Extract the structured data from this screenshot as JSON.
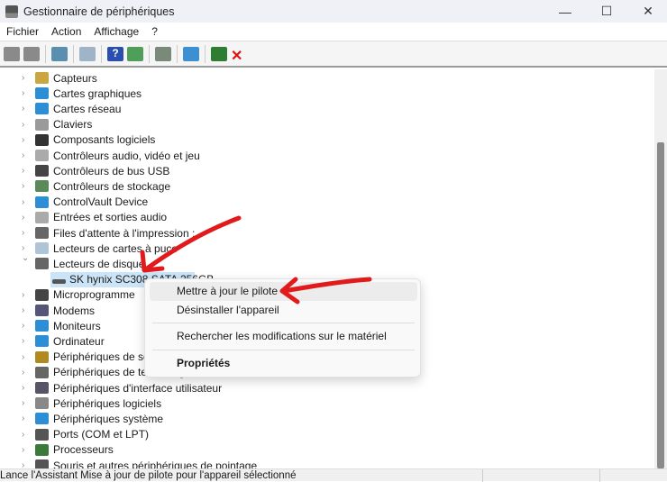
{
  "window": {
    "title": "Gestionnaire de périphériques",
    "minimize": "—",
    "maximize": "☐",
    "close": "✕"
  },
  "menubar": [
    "Fichier",
    "Action",
    "Affichage",
    "?"
  ],
  "toolbar": [
    {
      "icon": "back-arrow-icon",
      "color": "#8a8a8a"
    },
    {
      "icon": "forward-arrow-icon",
      "color": "#8a8a8a"
    },
    {
      "icon": "show-hide-console-tree-icon",
      "color": "#5b8fb0"
    },
    {
      "icon": "properties-icon",
      "color": "#a0b4c8"
    },
    {
      "icon": "help-icon",
      "color": "#2a4fb0"
    },
    {
      "icon": "action-pane-icon",
      "color": "#4f9e5a"
    },
    {
      "icon": "update-driver-icon",
      "color": "#7a8a7a"
    },
    {
      "icon": "scan-hardware-icon",
      "color": "#3c8fd0"
    },
    {
      "icon": "enable-device-icon",
      "color": "#2e7d32"
    },
    {
      "icon": "uninstall-device-icon",
      "color": "#e01010"
    }
  ],
  "tree": {
    "items": [
      {
        "label": "Capteurs",
        "color": "#c9a640"
      },
      {
        "label": "Cartes graphiques",
        "color": "#2c8fd6"
      },
      {
        "label": "Cartes réseau",
        "color": "#2c8fd6"
      },
      {
        "label": "Claviers",
        "color": "#9a9a9a"
      },
      {
        "label": "Composants logiciels",
        "color": "#333"
      },
      {
        "label": "Contrôleurs audio, vidéo et jeu",
        "color": "#aaa"
      },
      {
        "label": "Contrôleurs de bus USB",
        "color": "#444"
      },
      {
        "label": "Contrôleurs de stockage",
        "color": "#5a8a5a"
      },
      {
        "label": "ControlVault Device",
        "color": "#2c8fd6"
      },
      {
        "label": "Entrées et sorties audio",
        "color": "#aaa"
      },
      {
        "label": "Files d'attente à l'impression :",
        "color": "#666"
      },
      {
        "label": "Lecteurs de cartes à puce",
        "color": "#b0c4d8"
      },
      {
        "label": "Lecteurs de disque",
        "color": "#666",
        "expanded": true
      },
      {
        "label": "SK hynix SC308 SATA 256GB",
        "child": true,
        "selected": true
      },
      {
        "label": "Microprogramme",
        "color": "#444"
      },
      {
        "label": "Modems",
        "color": "#557"
      },
      {
        "label": "Moniteurs",
        "color": "#2c8fd6"
      },
      {
        "label": "Ordinateur",
        "color": "#2c8fd6"
      },
      {
        "label": "Périphériques de sécurité",
        "color": "#b08a20"
      },
      {
        "label": "Périphériques de technologie mémoire",
        "color": "#666"
      },
      {
        "label": "Périphériques d'interface utilisateur",
        "color": "#556"
      },
      {
        "label": "Périphériques logiciels",
        "color": "#888"
      },
      {
        "label": "Périphériques système",
        "color": "#2c8fd6"
      },
      {
        "label": "Ports (COM et LPT)",
        "color": "#555"
      },
      {
        "label": "Processeurs",
        "color": "#3a7a3a"
      },
      {
        "label": "Souris et autres périphériques de pointage",
        "color": "#555"
      }
    ]
  },
  "context_menu": {
    "update_driver": "Mettre à jour le pilote",
    "uninstall": "Désinstaller l'appareil",
    "scan": "Rechercher les modifications sur le matériel",
    "properties": "Propriétés"
  },
  "status": {
    "text": "Lance l'Assistant Mise à jour de pilote pour l'appareil sélectionné"
  },
  "annotation_color": "#e11b1b"
}
